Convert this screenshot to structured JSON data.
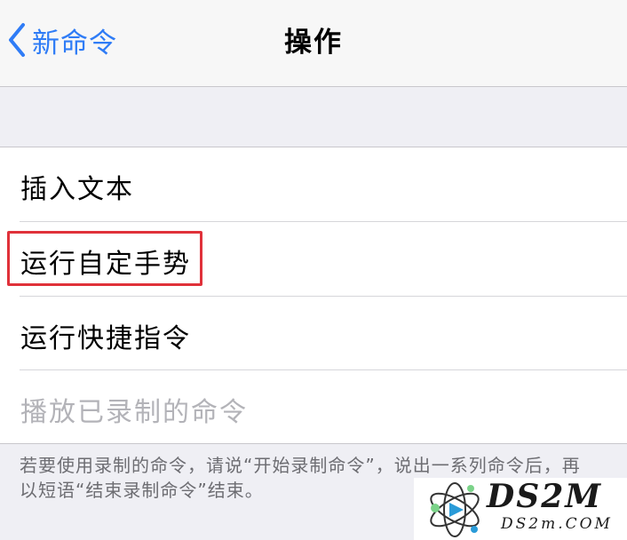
{
  "nav": {
    "back_label": "新命令",
    "title": "操作"
  },
  "list": {
    "items": [
      {
        "label": "插入文本",
        "enabled": true
      },
      {
        "label": "运行自定手势",
        "enabled": true,
        "highlighted": true
      },
      {
        "label": "运行快捷指令",
        "enabled": true
      },
      {
        "label": "播放已录制的命令",
        "enabled": false
      }
    ]
  },
  "footer": {
    "text": "若要使用录制的命令，请说“开始录制命令”，说出一系列命令后，再以短语“结束录制命令”结束。"
  },
  "watermark": {
    "title": "DS2M",
    "subtitle": "DS2m.COM"
  },
  "colors": {
    "accent": "#2f7cf6",
    "highlight": "#e0313a",
    "disabled_text": "#b3b3b8"
  }
}
